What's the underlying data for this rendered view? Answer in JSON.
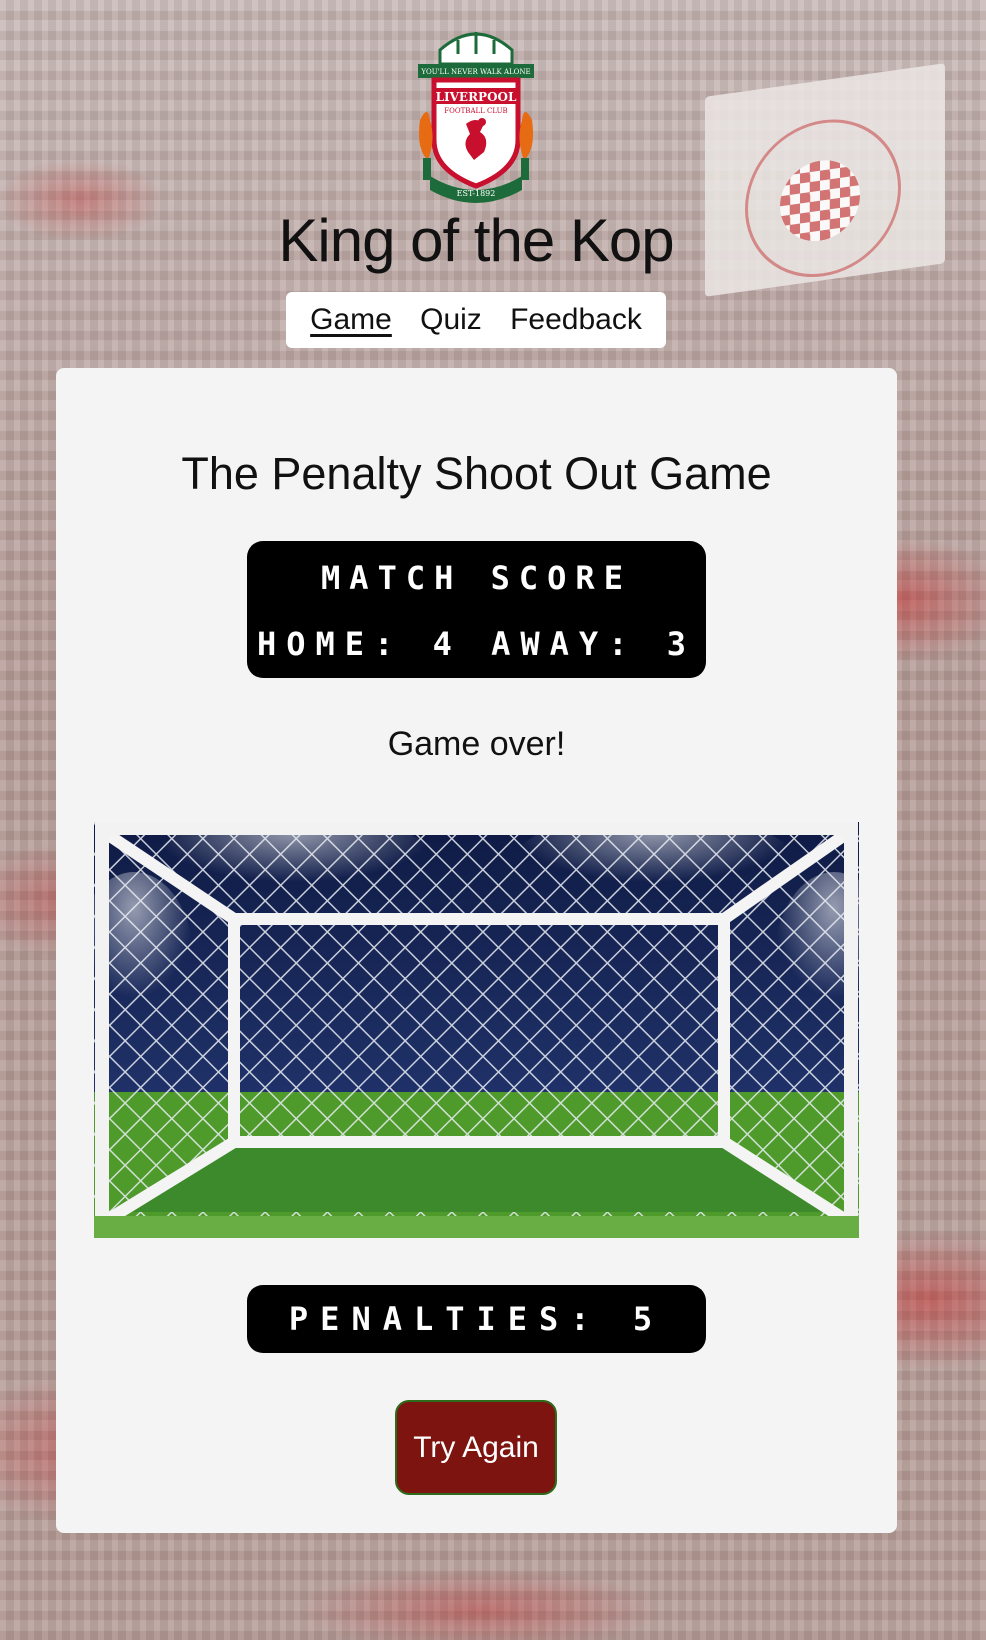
{
  "header": {
    "crest_text": {
      "motto": "YOU'LL NEVER WALK ALONE",
      "club": "LIVERPOOL",
      "sub": "FOOTBALL CLUB",
      "est": "EST-1892"
    },
    "title": "King of the Kop"
  },
  "nav": {
    "items": [
      {
        "label": "Game",
        "active": true
      },
      {
        "label": "Quiz",
        "active": false
      },
      {
        "label": "Feedback",
        "active": false
      }
    ]
  },
  "game": {
    "title": "The Penalty Shoot Out Game",
    "scoreboard": {
      "heading": "Match Score",
      "home_label": "Home:",
      "home_score": "4",
      "away_label": "Away:",
      "away_score": "3"
    },
    "status": "Game over!",
    "penalties_label": "Penalties:",
    "penalties_count": "5",
    "try_again_label": "Try Again"
  },
  "colors": {
    "button_bg": "#7e1410",
    "button_border": "#2d6a1b",
    "scoreboard_bg": "#000000",
    "card_bg": "#f4f4f4",
    "pitch_green": "#4e9a2a",
    "sky_navy": "#17275a"
  }
}
